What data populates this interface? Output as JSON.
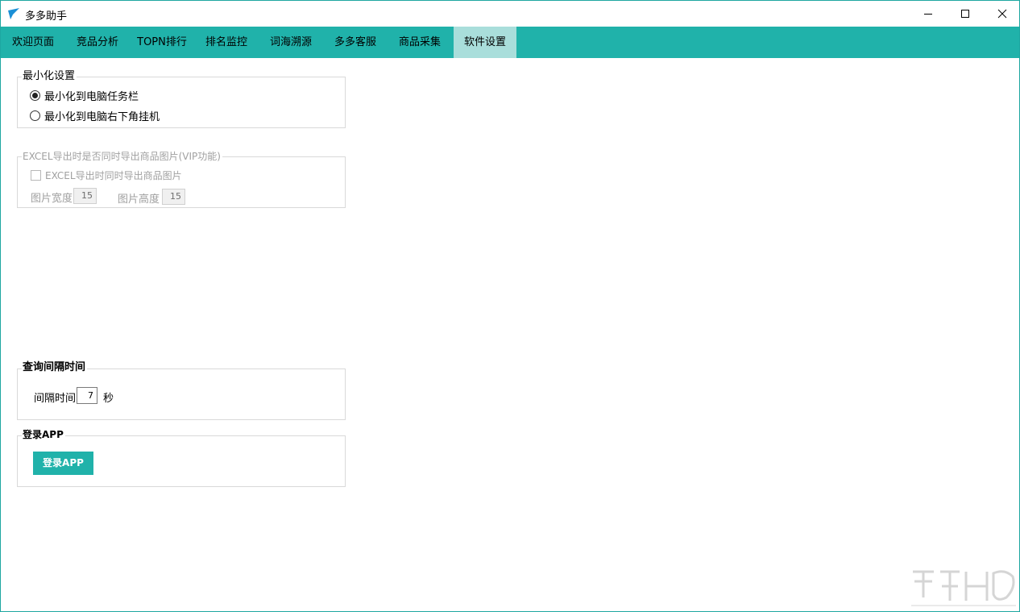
{
  "window": {
    "title": "多多助手",
    "accent": "#20b2aa",
    "active_tab_bg": "#a9dedb"
  },
  "tabs": [
    {
      "label": "欢迎页面",
      "active": false
    },
    {
      "label": "竞品分析",
      "active": false
    },
    {
      "label": "TOPN排行",
      "active": false
    },
    {
      "label": "排名监控",
      "active": false
    },
    {
      "label": "词海溯源",
      "active": false
    },
    {
      "label": "多多客服",
      "active": false
    },
    {
      "label": "商品采集",
      "active": false
    },
    {
      "label": "软件设置",
      "active": true
    }
  ],
  "minimize": {
    "title": "最小化设置",
    "options": [
      {
        "label": "最小化到电脑任务栏",
        "checked": true
      },
      {
        "label": "最小化到电脑右下角挂机",
        "checked": false
      }
    ]
  },
  "excel": {
    "title": "EXCEL导出时是否同时导出商品图片(VIP功能)",
    "checkbox_label": "EXCEL导出时同时导出商品图片",
    "checked": false,
    "width_label": "图片宽度",
    "width_value": "15",
    "height_label": "图片高度",
    "height_value": "15"
  },
  "interval": {
    "title": "查询间隔时间",
    "label": "间隔时间",
    "value": "7",
    "unit": "秒"
  },
  "login": {
    "title": "登录APP",
    "button": "登录APP"
  },
  "icons": {
    "logo": "app-logo-icon",
    "minimize": "minimize-icon",
    "maximize": "maximize-icon",
    "close": "close-icon"
  }
}
